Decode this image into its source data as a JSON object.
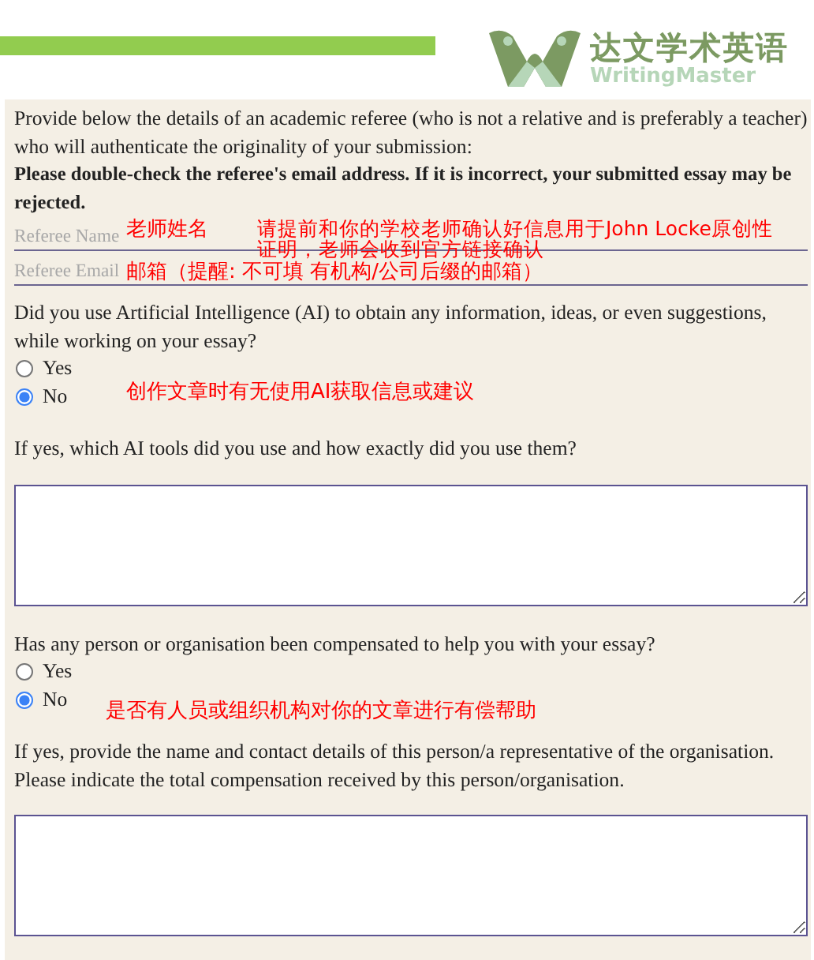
{
  "header": {
    "logo": {
      "name": "达文学术英语",
      "subtitle": "WritingMaster"
    }
  },
  "form": {
    "intro": "Provide below the details of an academic referee (who is not a relative and is preferably a teacher) who will authenticate the originality of your submission:",
    "warning": "Please double-check the referee's email address. If it is incorrect, your submitted essay may be rejected.",
    "fields": [
      {
        "placeholder": "Referee Name"
      },
      {
        "placeholder": "Referee Email"
      }
    ],
    "questions": [
      {
        "kind": "radio",
        "label": "Did you use Artificial Intelligence (AI) to obtain any information, ideas, or even suggestions, while working on your essay?",
        "options": [
          {
            "label": "Yes",
            "selected": false
          },
          {
            "label": "No",
            "selected": true
          }
        ]
      },
      {
        "kind": "textarea",
        "label": "If yes, which AI tools did you use and how exactly did you use them?"
      },
      {
        "kind": "radio",
        "label": "Has any person or organisation been compensated to help you with your essay?",
        "options": [
          {
            "label": "Yes",
            "selected": false
          },
          {
            "label": "No",
            "selected": true
          }
        ]
      },
      {
        "kind": "textarea",
        "label": "If yes, provide the name and contact details of this person/a representative of the organisation. Please indicate the total compensation received by this person/organisation."
      }
    ]
  },
  "annotations": [
    {
      "text": "老师姓名"
    },
    {
      "text": "请提前和你的学校老师确认好信息用于John Locke原创性证明，老师会收到官方链接确认"
    },
    {
      "text": "邮箱（提醒: 不可填 有机构/公司后缀的邮箱）"
    },
    {
      "text": "创作文章时有无使用AI获取信息或建议"
    },
    {
      "text": "是否有人员或组织机构对你的文章进行有偿帮助"
    }
  ]
}
